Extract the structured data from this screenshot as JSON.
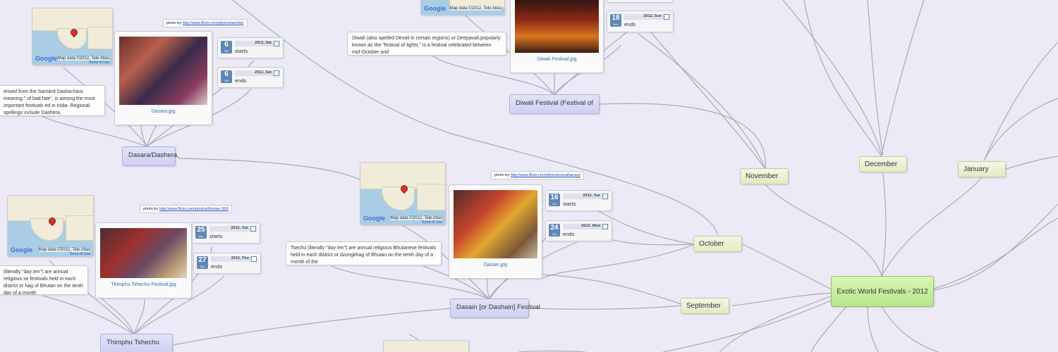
{
  "root": {
    "label": "Exotic World Festivals - 2012"
  },
  "months": {
    "november": "November",
    "december": "December",
    "january": "January",
    "october": "October",
    "september": "September"
  },
  "events": {
    "diwali": "Diwali Festival (Festival of",
    "dasara": "Dasara/Dashera,",
    "dasain": "Dasain [or Dashain] Festival",
    "thimphu": "Thimphu Tshechu"
  },
  "notes": {
    "diwali": "Diwali (also spelled Devali in certain regions) or Deepavali,popularly known as the \"festival of lights,\" is a festival celebrated between mid-October and",
    "dasara": "erived from the Sanskrit Dasha-hara meaning \" of bad fate\", is among the most important festivals ed in India. Regional spellings include Dashera,",
    "tshechu": "Tsechu (literally \"day ten\") are annual religious Bhutanese festivals held in each district or dzongkhag of Bhutan on the tenth day of a month of the",
    "thimphu": "(literally \"day ten\") are annual religious se festivals held in each district or hag of Bhutan on the tenth day of a month"
  },
  "photos": {
    "dasara": "Dasara.jpg",
    "diwali": "Diwali Festival.jpg",
    "dasain": "Dasain.jpg",
    "thimphu": "Thimphu Tshechu Festival.jpg"
  },
  "credits": {
    "dasara": {
      "prefix": "photo by",
      "url": "http://www.flickr.com/photos/amrkw/"
    },
    "dasain": {
      "prefix": "photo by",
      "url": "http://www.flickr.com/photos/zanaharuss/"
    },
    "thimphu": {
      "prefix": "photo by",
      "url": "http://www.flickr.com/photos/bhutan-360/"
    }
  },
  "maps": {
    "logo": "Google",
    "mapdata": "Map data ©2012, Tele Atlas",
    "terms": "Terms of Use"
  },
  "dates": {
    "dasara_start": {
      "day": "6",
      "mon": "Oct",
      "year": "2012, Sat",
      "label": "starts"
    },
    "dasara_end": {
      "day": "6",
      "mon": "Oct",
      "year": "2012, Sat",
      "label": "ends"
    },
    "diwali_end": {
      "day": "18",
      "mon": "Nov",
      "year": "2012, Sun",
      "label": "ends"
    },
    "dasain_start": {
      "day": "16",
      "mon": "Oct",
      "year": "2012, Tue",
      "label": "starts"
    },
    "dasain_end": {
      "day": "24",
      "mon": "Oct",
      "year": "2012, Wed",
      "label": "ends"
    },
    "thimphu_start": {
      "day": "25",
      "mon": "Sep",
      "year": "2012, Tue",
      "label": "starts"
    },
    "thimphu_end": {
      "day": "27",
      "mon": "Sep",
      "year": "2012, Thu",
      "label": "ends"
    }
  },
  "colors": {
    "link": "#a9a9bb",
    "root": "#b7e68c",
    "month": "#e5e9c4",
    "event": "#d0cff2",
    "background": "#eceaf6"
  }
}
